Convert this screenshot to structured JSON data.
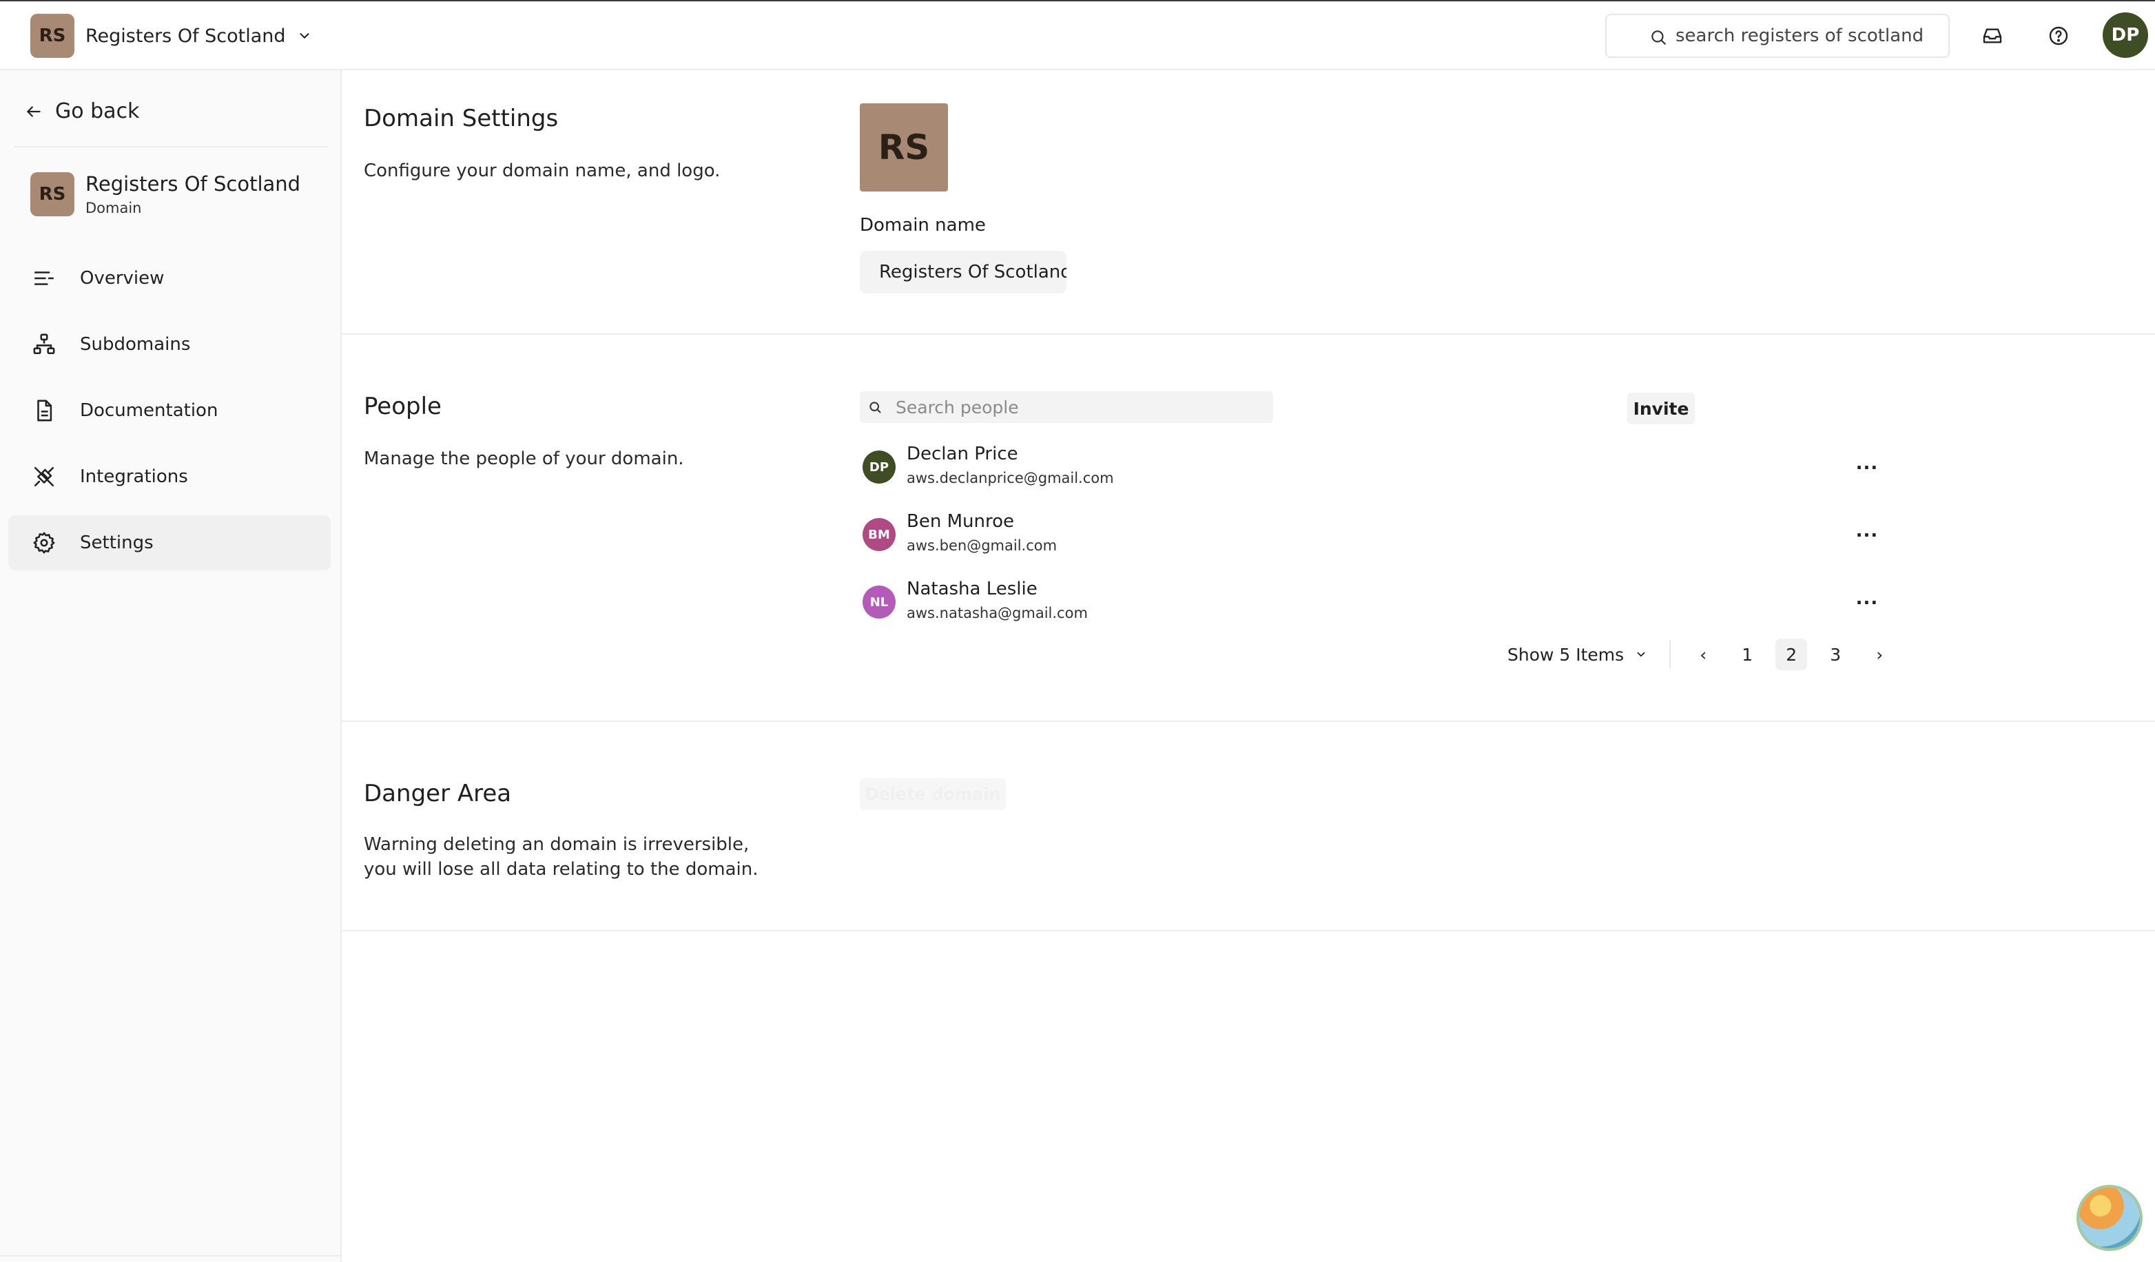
{
  "topbar": {
    "org_initials": "RS",
    "org_name": "Registers Of Scotland",
    "search_placeholder": "search registers of scotland",
    "user_initials": "DP",
    "icons": [
      "search-icon",
      "inbox-icon",
      "help-icon"
    ]
  },
  "sidebar": {
    "go_back": "Go back",
    "org_initials": "RS",
    "org_name": "Registers Of Scotland",
    "org_type": "Domain",
    "items": [
      {
        "label": "Overview",
        "icon": "overview-icon"
      },
      {
        "label": "Subdomains",
        "icon": "hierarchy-icon"
      },
      {
        "label": "Documentation",
        "icon": "document-icon"
      },
      {
        "label": "Integrations",
        "icon": "plug-icon"
      },
      {
        "label": "Settings",
        "icon": "gear-icon",
        "active": true
      }
    ]
  },
  "domain_settings": {
    "title": "Domain Settings",
    "description": "Configure your domain name, and logo.",
    "logo_initials": "RS",
    "field_label": "Domain name",
    "field_value": "Registers Of Scotland"
  },
  "people": {
    "title": "People",
    "description": "Manage the people of your domain.",
    "search_placeholder": "Search people",
    "invite_label": "Invite",
    "members": [
      {
        "initials": "DP",
        "name": "Declan Price",
        "email": "aws.declanprice@gmail.com",
        "color": "#3f4d25"
      },
      {
        "initials": "BM",
        "name": "Ben Munroe",
        "email": "aws.ben@gmail.com",
        "color": "#b04a82"
      },
      {
        "initials": "NL",
        "name": "Natasha Leslie",
        "email": "aws.natasha@gmail.com",
        "color": "#b45ab8"
      }
    ],
    "more_label": "...",
    "pagination": {
      "page_size_label": "Show 5 Items",
      "prev": "‹",
      "next": "›",
      "pages": [
        "1",
        "2",
        "3"
      ],
      "current_page": "2"
    }
  },
  "danger_area": {
    "title": "Danger Area",
    "description": "Warning deleting an domain is irreversible, you will lose all data relating to the domain.",
    "delete_label": "Delete domain"
  }
}
